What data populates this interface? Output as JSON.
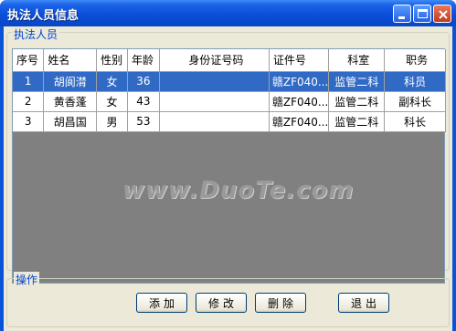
{
  "window": {
    "title": "执法人员信息"
  },
  "group_people": {
    "legend": "执法人员"
  },
  "table": {
    "columns": [
      "序号",
      "姓名",
      "性别",
      "年龄",
      "身份证号码",
      "证件号",
      "科室",
      "职务"
    ],
    "rows": [
      [
        "1",
        "胡阆潸",
        "女",
        "36",
        "",
        "赣ZF040...",
        "监管二科",
        "科员"
      ],
      [
        "2",
        "黄香蓬",
        "女",
        "43",
        "",
        "赣ZF040...",
        "监管二科",
        "副科长"
      ],
      [
        "3",
        "胡昌国",
        "男",
        "53",
        "",
        "赣ZF040...",
        "监管二科",
        "科长"
      ]
    ],
    "selected_row": 0
  },
  "watermark": "www.DuoTe.com",
  "group_actions": {
    "legend": "操作"
  },
  "buttons": {
    "add": "添加",
    "edit": "修改",
    "delete": "删除",
    "exit": "退出"
  },
  "colors": {
    "title_blue": "#0a4fd8",
    "selection": "#316ac5",
    "legend_text": "#0046d5",
    "face": "#ece9d8"
  }
}
